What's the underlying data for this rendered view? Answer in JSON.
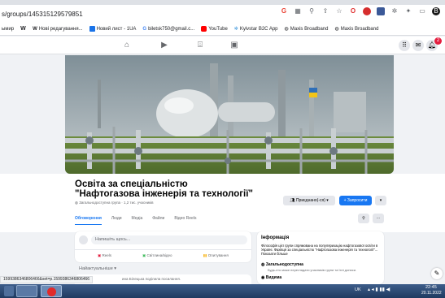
{
  "browser": {
    "url": "s/groups/145315129579851",
    "bookmarks": [
      {
        "label": "ымир",
        "icon": "w-icon"
      },
      {
        "label": "W",
        "icon": "w-icon"
      },
      {
        "label": "Нові редагування...",
        "icon": "w-icon"
      },
      {
        "label": "Новий лист - 1UA",
        "icon": "mail-icon"
      },
      {
        "label": "biletsk750@gmail.c...",
        "icon": "google-icon"
      },
      {
        "label": "YouTube",
        "icon": "youtube-icon"
      },
      {
        "label": "Kyivstar B2C App",
        "icon": "star-icon"
      },
      {
        "label": "Maxis Broadband",
        "icon": "globe-icon"
      },
      {
        "label": "Maxis Broadband",
        "icon": "globe-icon"
      }
    ],
    "status_url": "1599386346806466&set=p.1599386346806466"
  },
  "facebook": {
    "notification_count": "2"
  },
  "group": {
    "title": "Освіта за спеціальністю \"Нафтогазова інженерія та технології\"",
    "meta": "Загальнодоступна група · 1,2 тис. учасників",
    "joined_label": "Приєднано(-ся)",
    "invite_label": "+ Запросити",
    "tabs": [
      "Обговорення",
      "Люди",
      "Медіа",
      "Файли",
      "Відео Reels"
    ]
  },
  "composer": {
    "placeholder": "Напишіть щось...",
    "actions": [
      "Reels",
      "Світлина/відео",
      "Опитування"
    ],
    "sort_label": "Найактуальніше",
    "post_preview": "ина Білецька поділила посилання."
  },
  "info": {
    "heading": "Інформація",
    "description": "Філософія цієї групи спрямована на популяризацію нафтогазової освіти в Україні. Фахівця за спеціальністю \"Нафтогазова інженерія та технології\"... Показати більше",
    "public_label": "Загальнодоступна",
    "public_desc": "Будь-хто може переглядати учасників групи та їхні дописи.",
    "visible_label": "Видима"
  },
  "taskbar": {
    "lang": "UK",
    "time": "22:45",
    "date": "20.11.2022"
  },
  "colors": {
    "fb_blue": "#1877f2",
    "taskbar": "#2b4a75"
  }
}
